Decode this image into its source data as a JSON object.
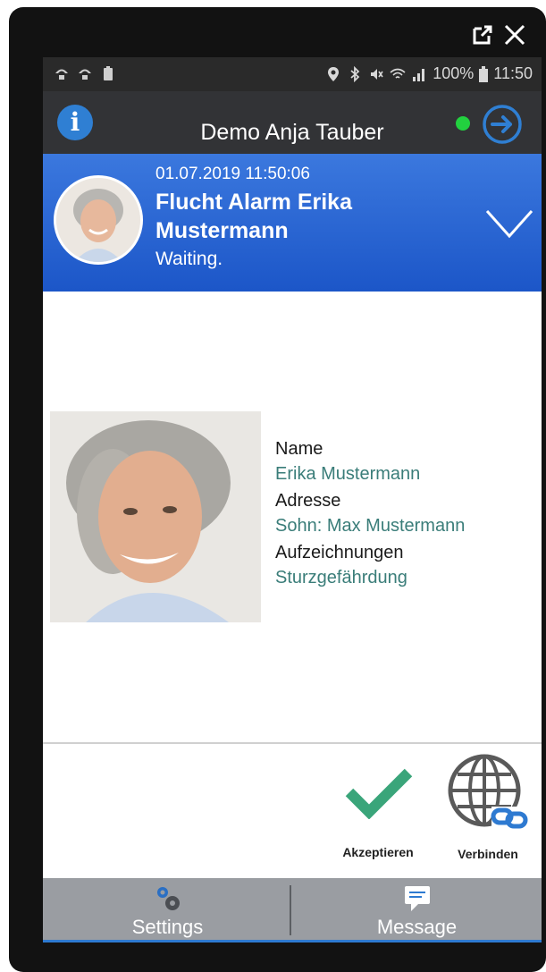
{
  "window": {
    "popout_icon": "external-link-icon",
    "close_icon": "close-icon"
  },
  "statusbar": {
    "left_icons": [
      "notification-icon",
      "notification-icon",
      "battery-saver-icon"
    ],
    "right_icons": [
      "location-icon",
      "bluetooth-icon",
      "mute-icon",
      "wifi-icon",
      "signal-icon"
    ],
    "battery": "100%",
    "time": "11:50"
  },
  "header": {
    "title": "Demo Anja Tauber",
    "info_icon_text": "i",
    "online_color": "#22d13f"
  },
  "alarm": {
    "datetime": "01.07.2019 11:50:06",
    "title": "Flucht Alarm Erika Mustermann",
    "status": "Waiting."
  },
  "person": {
    "fields": [
      {
        "label": "Name",
        "value": "Erika Mustermann"
      },
      {
        "label": "Adresse",
        "value": "Sohn: Max Mustermann"
      },
      {
        "label": "Aufzeichnungen",
        "value": "Sturzgefährdung"
      }
    ]
  },
  "actions": {
    "accept_label": "Akzeptieren",
    "connect_label": "Verbinden",
    "accept_color": "#3aa57a"
  },
  "tabs": [
    {
      "label": "Settings",
      "icon": "gears-icon"
    },
    {
      "label": "Message",
      "icon": "chat-icon"
    }
  ],
  "colors": {
    "accent": "#2e7ad1",
    "alarm_blue": "#2563d0",
    "value_teal": "#3a7d79"
  }
}
